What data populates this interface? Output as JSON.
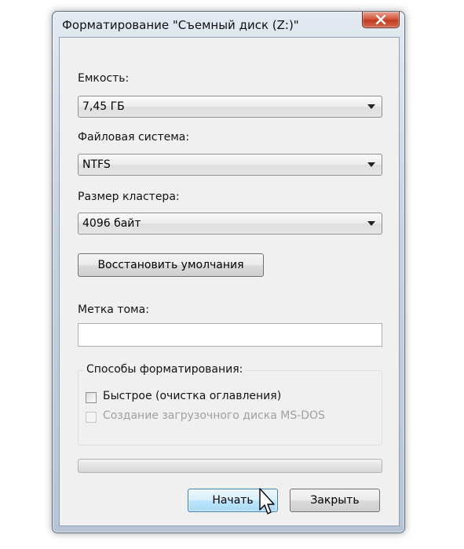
{
  "window": {
    "title": "Форматирование \"Съемный диск (Z:)\""
  },
  "capacity": {
    "label": "Емкость:",
    "value": "7,45 ГБ"
  },
  "filesystem": {
    "label": "Файловая система:",
    "value": "NTFS"
  },
  "cluster": {
    "label": "Размер кластера:",
    "value": "4096 байт"
  },
  "restore_button": {
    "label": "Восстановить умолчания"
  },
  "volume_label": {
    "label": "Метка тома:",
    "value": ""
  },
  "format_options": {
    "legend": "Способы форматирования:",
    "quick": {
      "label": "Быстрое (очистка оглавления)",
      "checked": false,
      "enabled": true
    },
    "msdos": {
      "label": "Создание загрузочного диска MS-DOS",
      "checked": false,
      "enabled": false
    }
  },
  "progress": {
    "fraction": 0
  },
  "buttons": {
    "start": "Начать",
    "close": "Закрыть"
  },
  "icons": {
    "close": "close-icon",
    "dropdown": "chevron-down-icon",
    "cursor": "mouse-pointer-icon"
  },
  "colors": {
    "default_button_border": "#3c7fb1",
    "close_button": "#c13b20"
  }
}
